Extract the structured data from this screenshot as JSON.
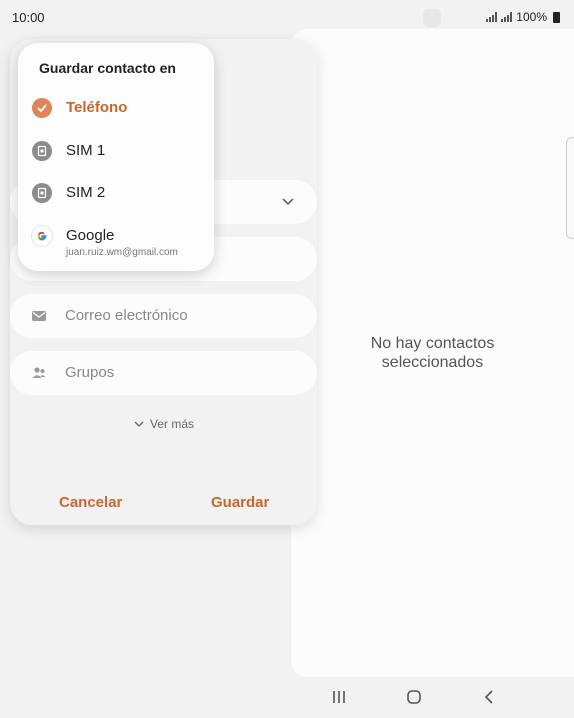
{
  "status": {
    "time": "10:00",
    "battery": "100%"
  },
  "popup": {
    "title": "Guardar contacto en",
    "options": [
      {
        "label": "Teléfono",
        "icon": "checkmark-circle-icon",
        "selected": true
      },
      {
        "label": "SIM 1",
        "icon": "sim-card-icon",
        "selected": false
      },
      {
        "label": "SIM 2",
        "icon": "sim-card-icon",
        "selected": false
      },
      {
        "label": "Google",
        "sub": "juan.ruiz.wm@gmail.com",
        "icon": "google-icon",
        "selected": false
      }
    ]
  },
  "form": {
    "email_placeholder": "Correo electrónico",
    "groups_placeholder": "Grupos",
    "more_label": "Ver más",
    "cancel": "Cancelar",
    "save": "Guardar"
  },
  "right_panel": {
    "empty_text": "No hay contactos seleccionados"
  },
  "colors": {
    "accent": "#c8662e",
    "selected_option": "#e0845a"
  }
}
